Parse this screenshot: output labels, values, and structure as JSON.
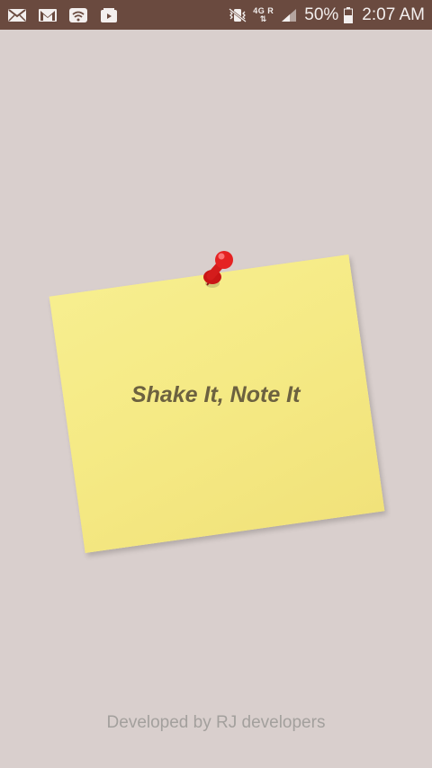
{
  "status_bar": {
    "left_icons": [
      "email-icon",
      "gmail-icon",
      "wifi-icon",
      "media-icon"
    ],
    "network_top": "4G R",
    "battery_percent": "50%",
    "time": "2:07 AM"
  },
  "note": {
    "title": "Shake It, Note It"
  },
  "footer": {
    "text": "Developed by RJ developers"
  },
  "colors": {
    "status_bar": "#6a4a3f",
    "background": "#d9cfcd",
    "note": "#f5ea85",
    "note_text": "#6c6140",
    "pin": "#e02020",
    "footer_text": "#a3a09d"
  }
}
